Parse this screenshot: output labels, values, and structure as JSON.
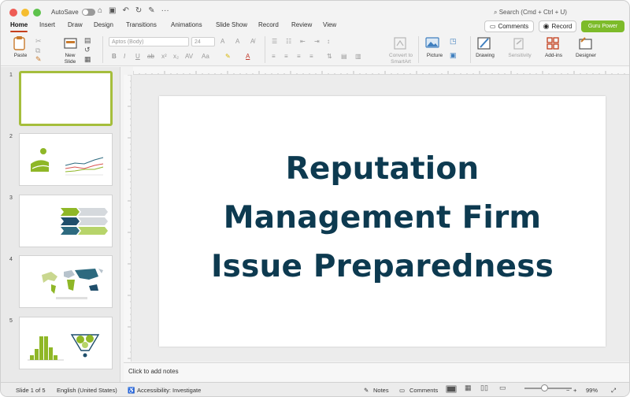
{
  "titlebar": {
    "autosave_label": "AutoSave",
    "search_placeholder": "Search (Cmd + Ctrl + U)",
    "dots": [
      "#ee5c55",
      "#f5bd30",
      "#5dc24c"
    ]
  },
  "tabs": [
    "Home",
    "Insert",
    "Draw",
    "Design",
    "Transitions",
    "Animations",
    "Slide Show",
    "Record",
    "Review",
    "View"
  ],
  "top_buttons": {
    "comments_label": "Comments",
    "record_label": "Record",
    "guru_label": "Guru Power",
    "accent": "#7dbb2a"
  },
  "ribbon": {
    "paste_label": "Paste",
    "new_slide_label": "New\nSlide",
    "font_name": "Aptos (Body)",
    "font_size": "24",
    "convert_label": "Convert to\nSmartArt",
    "picture_label": "Picture",
    "drawing_label": "Drawing",
    "sensitivity_label": "Sensitivity",
    "addins_label": "Add-ins",
    "designer_label": "Designer"
  },
  "slides": [
    {
      "number": "1",
      "selected": true
    },
    {
      "number": "2",
      "selected": false
    },
    {
      "number": "3",
      "selected": false
    },
    {
      "number": "4",
      "selected": false
    },
    {
      "number": "5",
      "selected": false
    }
  ],
  "main_slide": {
    "title_lines": [
      "Reputation",
      "Management Firm",
      "Issue Preparedness"
    ],
    "title_color": "#0d3a50"
  },
  "notes_placeholder": "Click to add notes",
  "status": {
    "slide_count": "Slide 1 of 5",
    "language": "English (United States)",
    "accessibility": "Accessibility: Investigate",
    "notes_label": "Notes",
    "comments_label": "Comments",
    "zoom": "99%"
  }
}
